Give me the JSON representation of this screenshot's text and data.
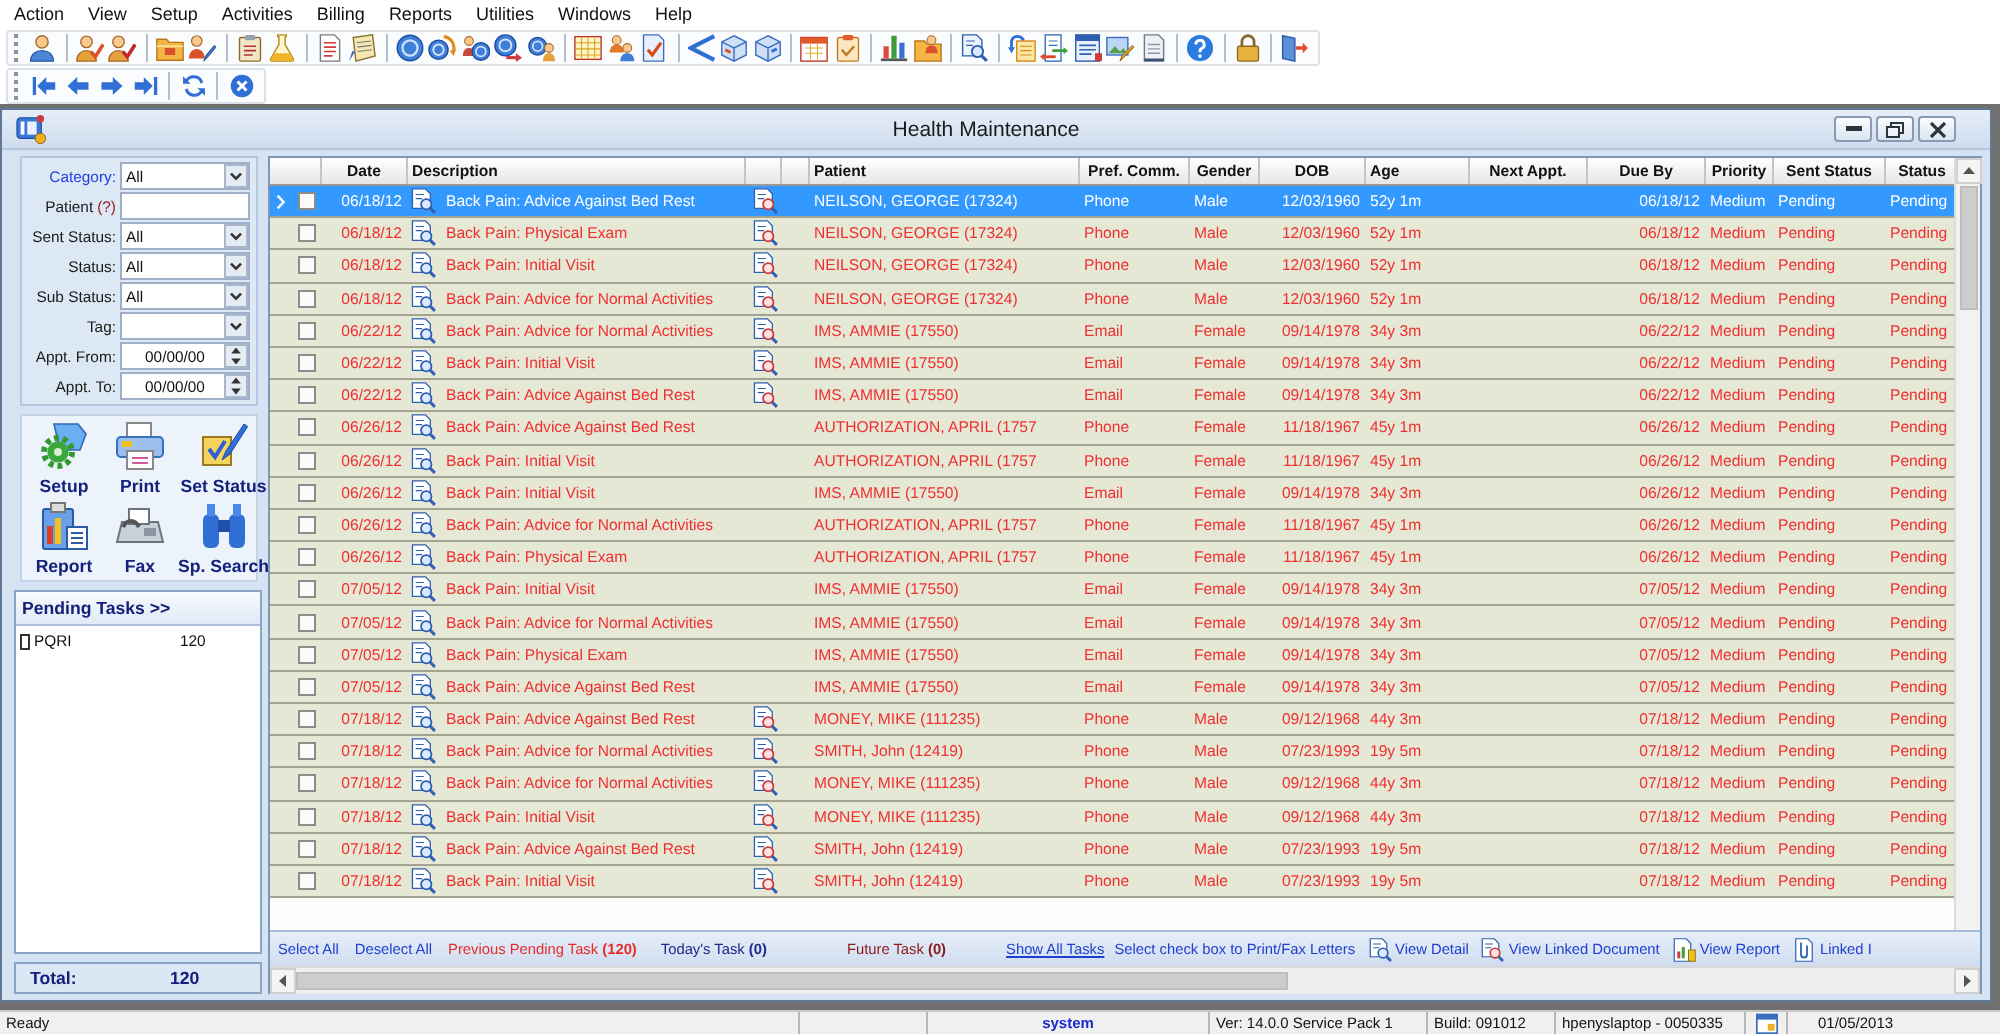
{
  "menu": [
    "Action",
    "View",
    "Setup",
    "Activities",
    "Billing",
    "Reports",
    "Utilities",
    "Windows",
    "Help"
  ],
  "window": {
    "title": "Health Maintenance"
  },
  "filters": [
    {
      "kind": "select",
      "label": "Category:",
      "link": true,
      "value": "All"
    },
    {
      "kind": "text",
      "label": "Patient",
      "link": false,
      "help": "(?)"
    },
    {
      "kind": "select",
      "label": "Sent Status:",
      "link": false,
      "value": "All"
    },
    {
      "kind": "select",
      "label": "Status:",
      "link": false,
      "value": "All"
    },
    {
      "kind": "select",
      "label": "Sub Status:",
      "link": false,
      "value": "All"
    },
    {
      "kind": "select",
      "label": "Tag:",
      "link": false
    },
    {
      "kind": "spin",
      "label": "Appt. From:",
      "link": false,
      "value": "00/00/00"
    },
    {
      "kind": "spin",
      "label": "Appt. To:",
      "link": false,
      "value": "00/00/00"
    }
  ],
  "actions": [
    "Setup",
    "Print",
    "Set Status",
    "Report",
    "Fax",
    "Sp. Search"
  ],
  "pending_tasks": {
    "title": "Pending Tasks >>",
    "items": [
      {
        "name": "PQRI",
        "count": "120"
      }
    ]
  },
  "total": {
    "label": "Total:",
    "value": "120"
  },
  "table": {
    "columns": [
      "Date",
      "Description",
      "Patient",
      "Pref. Comm.",
      "Gender",
      "DOB",
      "Age",
      "Next Appt.",
      "Due By",
      "Priority",
      "Sent Status",
      "Status"
    ],
    "rows": [
      {
        "date": "06/18/12",
        "description": "Back Pain: Advice Against Bed Rest",
        "linked_document": true,
        "patient": "NEILSON, GEORGE (17324)",
        "pref_comm": "Phone",
        "gender": "Male",
        "dob": "12/03/1960",
        "age": "52y 1m",
        "due_by": "06/18/12",
        "priority": "Medium",
        "sent_status": "Pending",
        "status": "Pending",
        "checked": false,
        "selected": true
      },
      {
        "date": "06/18/12",
        "description": "Back Pain: Physical Exam",
        "linked_document": true,
        "patient": "NEILSON, GEORGE (17324)",
        "pref_comm": "Phone",
        "gender": "Male",
        "dob": "12/03/1960",
        "age": "52y 1m",
        "due_by": "06/18/12",
        "priority": "Medium",
        "sent_status": "Pending",
        "status": "Pending",
        "checked": false,
        "selected": false
      },
      {
        "date": "06/18/12",
        "description": "Back Pain: Initial Visit",
        "linked_document": true,
        "patient": "NEILSON, GEORGE (17324)",
        "pref_comm": "Phone",
        "gender": "Male",
        "dob": "12/03/1960",
        "age": "52y 1m",
        "due_by": "06/18/12",
        "priority": "Medium",
        "sent_status": "Pending",
        "status": "Pending",
        "checked": false,
        "selected": false
      },
      {
        "date": "06/18/12",
        "description": "Back Pain: Advice for Normal Activities",
        "linked_document": true,
        "patient": "NEILSON, GEORGE (17324)",
        "pref_comm": "Phone",
        "gender": "Male",
        "dob": "12/03/1960",
        "age": "52y 1m",
        "due_by": "06/18/12",
        "priority": "Medium",
        "sent_status": "Pending",
        "status": "Pending",
        "checked": false,
        "selected": false
      },
      {
        "date": "06/22/12",
        "description": "Back Pain: Advice for Normal Activities",
        "linked_document": true,
        "patient": "IMS, AMMIE (17550)",
        "pref_comm": "Email",
        "gender": "Female",
        "dob": "09/14/1978",
        "age": "34y 3m",
        "due_by": "06/22/12",
        "priority": "Medium",
        "sent_status": "Pending",
        "status": "Pending",
        "checked": false,
        "selected": false
      },
      {
        "date": "06/22/12",
        "description": "Back Pain: Initial Visit",
        "linked_document": true,
        "patient": "IMS, AMMIE (17550)",
        "pref_comm": "Email",
        "gender": "Female",
        "dob": "09/14/1978",
        "age": "34y 3m",
        "due_by": "06/22/12",
        "priority": "Medium",
        "sent_status": "Pending",
        "status": "Pending",
        "checked": false,
        "selected": false
      },
      {
        "date": "06/22/12",
        "description": "Back Pain: Advice Against Bed Rest",
        "linked_document": true,
        "patient": "IMS, AMMIE (17550)",
        "pref_comm": "Email",
        "gender": "Female",
        "dob": "09/14/1978",
        "age": "34y 3m",
        "due_by": "06/22/12",
        "priority": "Medium",
        "sent_status": "Pending",
        "status": "Pending",
        "checked": false,
        "selected": false
      },
      {
        "date": "06/26/12",
        "description": "Back Pain: Advice Against Bed Rest",
        "linked_document": false,
        "patient": "AUTHORIZATION, APRIL (1757",
        "pref_comm": "Phone",
        "gender": "Female",
        "dob": "11/18/1967",
        "age": "45y 1m",
        "due_by": "06/26/12",
        "priority": "Medium",
        "sent_status": "Pending",
        "status": "Pending",
        "checked": false,
        "selected": false
      },
      {
        "date": "06/26/12",
        "description": "Back Pain: Initial Visit",
        "linked_document": false,
        "patient": "AUTHORIZATION, APRIL (1757",
        "pref_comm": "Phone",
        "gender": "Female",
        "dob": "11/18/1967",
        "age": "45y 1m",
        "due_by": "06/26/12",
        "priority": "Medium",
        "sent_status": "Pending",
        "status": "Pending",
        "checked": false,
        "selected": false
      },
      {
        "date": "06/26/12",
        "description": "Back Pain: Initial Visit",
        "linked_document": false,
        "patient": "IMS, AMMIE (17550)",
        "pref_comm": "Email",
        "gender": "Female",
        "dob": "09/14/1978",
        "age": "34y 3m",
        "due_by": "06/26/12",
        "priority": "Medium",
        "sent_status": "Pending",
        "status": "Pending",
        "checked": false,
        "selected": false
      },
      {
        "date": "06/26/12",
        "description": "Back Pain: Advice for Normal Activities",
        "linked_document": false,
        "patient": "AUTHORIZATION, APRIL (1757",
        "pref_comm": "Phone",
        "gender": "Female",
        "dob": "11/18/1967",
        "age": "45y 1m",
        "due_by": "06/26/12",
        "priority": "Medium",
        "sent_status": "Pending",
        "status": "Pending",
        "checked": false,
        "selected": false
      },
      {
        "date": "06/26/12",
        "description": "Back Pain: Physical Exam",
        "linked_document": false,
        "patient": "AUTHORIZATION, APRIL (1757",
        "pref_comm": "Phone",
        "gender": "Female",
        "dob": "11/18/1967",
        "age": "45y 1m",
        "due_by": "06/26/12",
        "priority": "Medium",
        "sent_status": "Pending",
        "status": "Pending",
        "checked": false,
        "selected": false
      },
      {
        "date": "07/05/12",
        "description": "Back Pain: Initial Visit",
        "linked_document": false,
        "patient": "IMS, AMMIE (17550)",
        "pref_comm": "Email",
        "gender": "Female",
        "dob": "09/14/1978",
        "age": "34y 3m",
        "due_by": "07/05/12",
        "priority": "Medium",
        "sent_status": "Pending",
        "status": "Pending",
        "checked": false,
        "selected": false
      },
      {
        "date": "07/05/12",
        "description": "Back Pain: Advice for Normal Activities",
        "linked_document": false,
        "patient": "IMS, AMMIE (17550)",
        "pref_comm": "Email",
        "gender": "Female",
        "dob": "09/14/1978",
        "age": "34y 3m",
        "due_by": "07/05/12",
        "priority": "Medium",
        "sent_status": "Pending",
        "status": "Pending",
        "checked": false,
        "selected": false
      },
      {
        "date": "07/05/12",
        "description": "Back Pain: Physical Exam",
        "linked_document": false,
        "patient": "IMS, AMMIE (17550)",
        "pref_comm": "Email",
        "gender": "Female",
        "dob": "09/14/1978",
        "age": "34y 3m",
        "due_by": "07/05/12",
        "priority": "Medium",
        "sent_status": "Pending",
        "status": "Pending",
        "checked": false,
        "selected": false
      },
      {
        "date": "07/05/12",
        "description": "Back Pain: Advice Against Bed Rest",
        "linked_document": false,
        "patient": "IMS, AMMIE (17550)",
        "pref_comm": "Email",
        "gender": "Female",
        "dob": "09/14/1978",
        "age": "34y 3m",
        "due_by": "07/05/12",
        "priority": "Medium",
        "sent_status": "Pending",
        "status": "Pending",
        "checked": false,
        "selected": false
      },
      {
        "date": "07/18/12",
        "description": "Back Pain: Advice Against Bed Rest",
        "linked_document": true,
        "patient": "MONEY, MIKE (111235)",
        "pref_comm": "Phone",
        "gender": "Male",
        "dob": "09/12/1968",
        "age": "44y 3m",
        "due_by": "07/18/12",
        "priority": "Medium",
        "sent_status": "Pending",
        "status": "Pending",
        "checked": false,
        "selected": false
      },
      {
        "date": "07/18/12",
        "description": "Back Pain: Advice for Normal Activities",
        "linked_document": true,
        "patient": "SMITH, John (12419)",
        "pref_comm": "Phone",
        "gender": "Male",
        "dob": "07/23/1993",
        "age": "19y 5m",
        "due_by": "07/18/12",
        "priority": "Medium",
        "sent_status": "Pending",
        "status": "Pending",
        "checked": false,
        "selected": false
      },
      {
        "date": "07/18/12",
        "description": "Back Pain: Advice for Normal Activities",
        "linked_document": true,
        "patient": "MONEY, MIKE (111235)",
        "pref_comm": "Phone",
        "gender": "Male",
        "dob": "09/12/1968",
        "age": "44y 3m",
        "due_by": "07/18/12",
        "priority": "Medium",
        "sent_status": "Pending",
        "status": "Pending",
        "checked": false,
        "selected": false
      },
      {
        "date": "07/18/12",
        "description": "Back Pain: Initial Visit",
        "linked_document": true,
        "patient": "MONEY, MIKE (111235)",
        "pref_comm": "Phone",
        "gender": "Male",
        "dob": "09/12/1968",
        "age": "44y 3m",
        "due_by": "07/18/12",
        "priority": "Medium",
        "sent_status": "Pending",
        "status": "Pending",
        "checked": false,
        "selected": false
      },
      {
        "date": "07/18/12",
        "description": "Back Pain: Advice Against Bed Rest",
        "linked_document": true,
        "patient": "SMITH, John (12419)",
        "pref_comm": "Phone",
        "gender": "Male",
        "dob": "07/23/1993",
        "age": "19y 5m",
        "due_by": "07/18/12",
        "priority": "Medium",
        "sent_status": "Pending",
        "status": "Pending",
        "checked": false,
        "selected": false
      },
      {
        "date": "07/18/12",
        "description": "Back Pain: Initial Visit",
        "linked_document": true,
        "patient": "SMITH, John (12419)",
        "pref_comm": "Phone",
        "gender": "Male",
        "dob": "07/23/1993",
        "age": "19y 5m",
        "due_by": "07/18/12",
        "priority": "Medium",
        "sent_status": "Pending",
        "status": "Pending",
        "checked": false,
        "selected": false
      }
    ]
  },
  "task_bar": [
    {
      "kind": "link",
      "text": "Select All"
    },
    {
      "kind": "link",
      "text": "Deselect All"
    },
    {
      "kind": "previous",
      "text": "Previous Pending Task **(120)**"
    },
    {
      "kind": "today",
      "text": "Today's Task **(0)**"
    },
    {
      "kind": "future",
      "text": "Future Task **(0)**"
    },
    {
      "kind": "underlined",
      "text": "Show All Tasks"
    },
    {
      "kind": "hint",
      "text": "Select check box to Print/Fax Letters"
    },
    {
      "kind": "action",
      "text": "View Detail"
    },
    {
      "kind": "action",
      "text": "View Linked Document"
    },
    {
      "kind": "action",
      "text": "View Report"
    },
    {
      "kind": "action",
      "text": "Linked I"
    }
  ],
  "status_bar": {
    "message": "Ready",
    "user": "system",
    "version": "Ver: 14.0.0 Service Pack 1",
    "build": "Build: 091012",
    "machine": "hpenyslaptop - 0050335",
    "date": "01/05/2013"
  }
}
